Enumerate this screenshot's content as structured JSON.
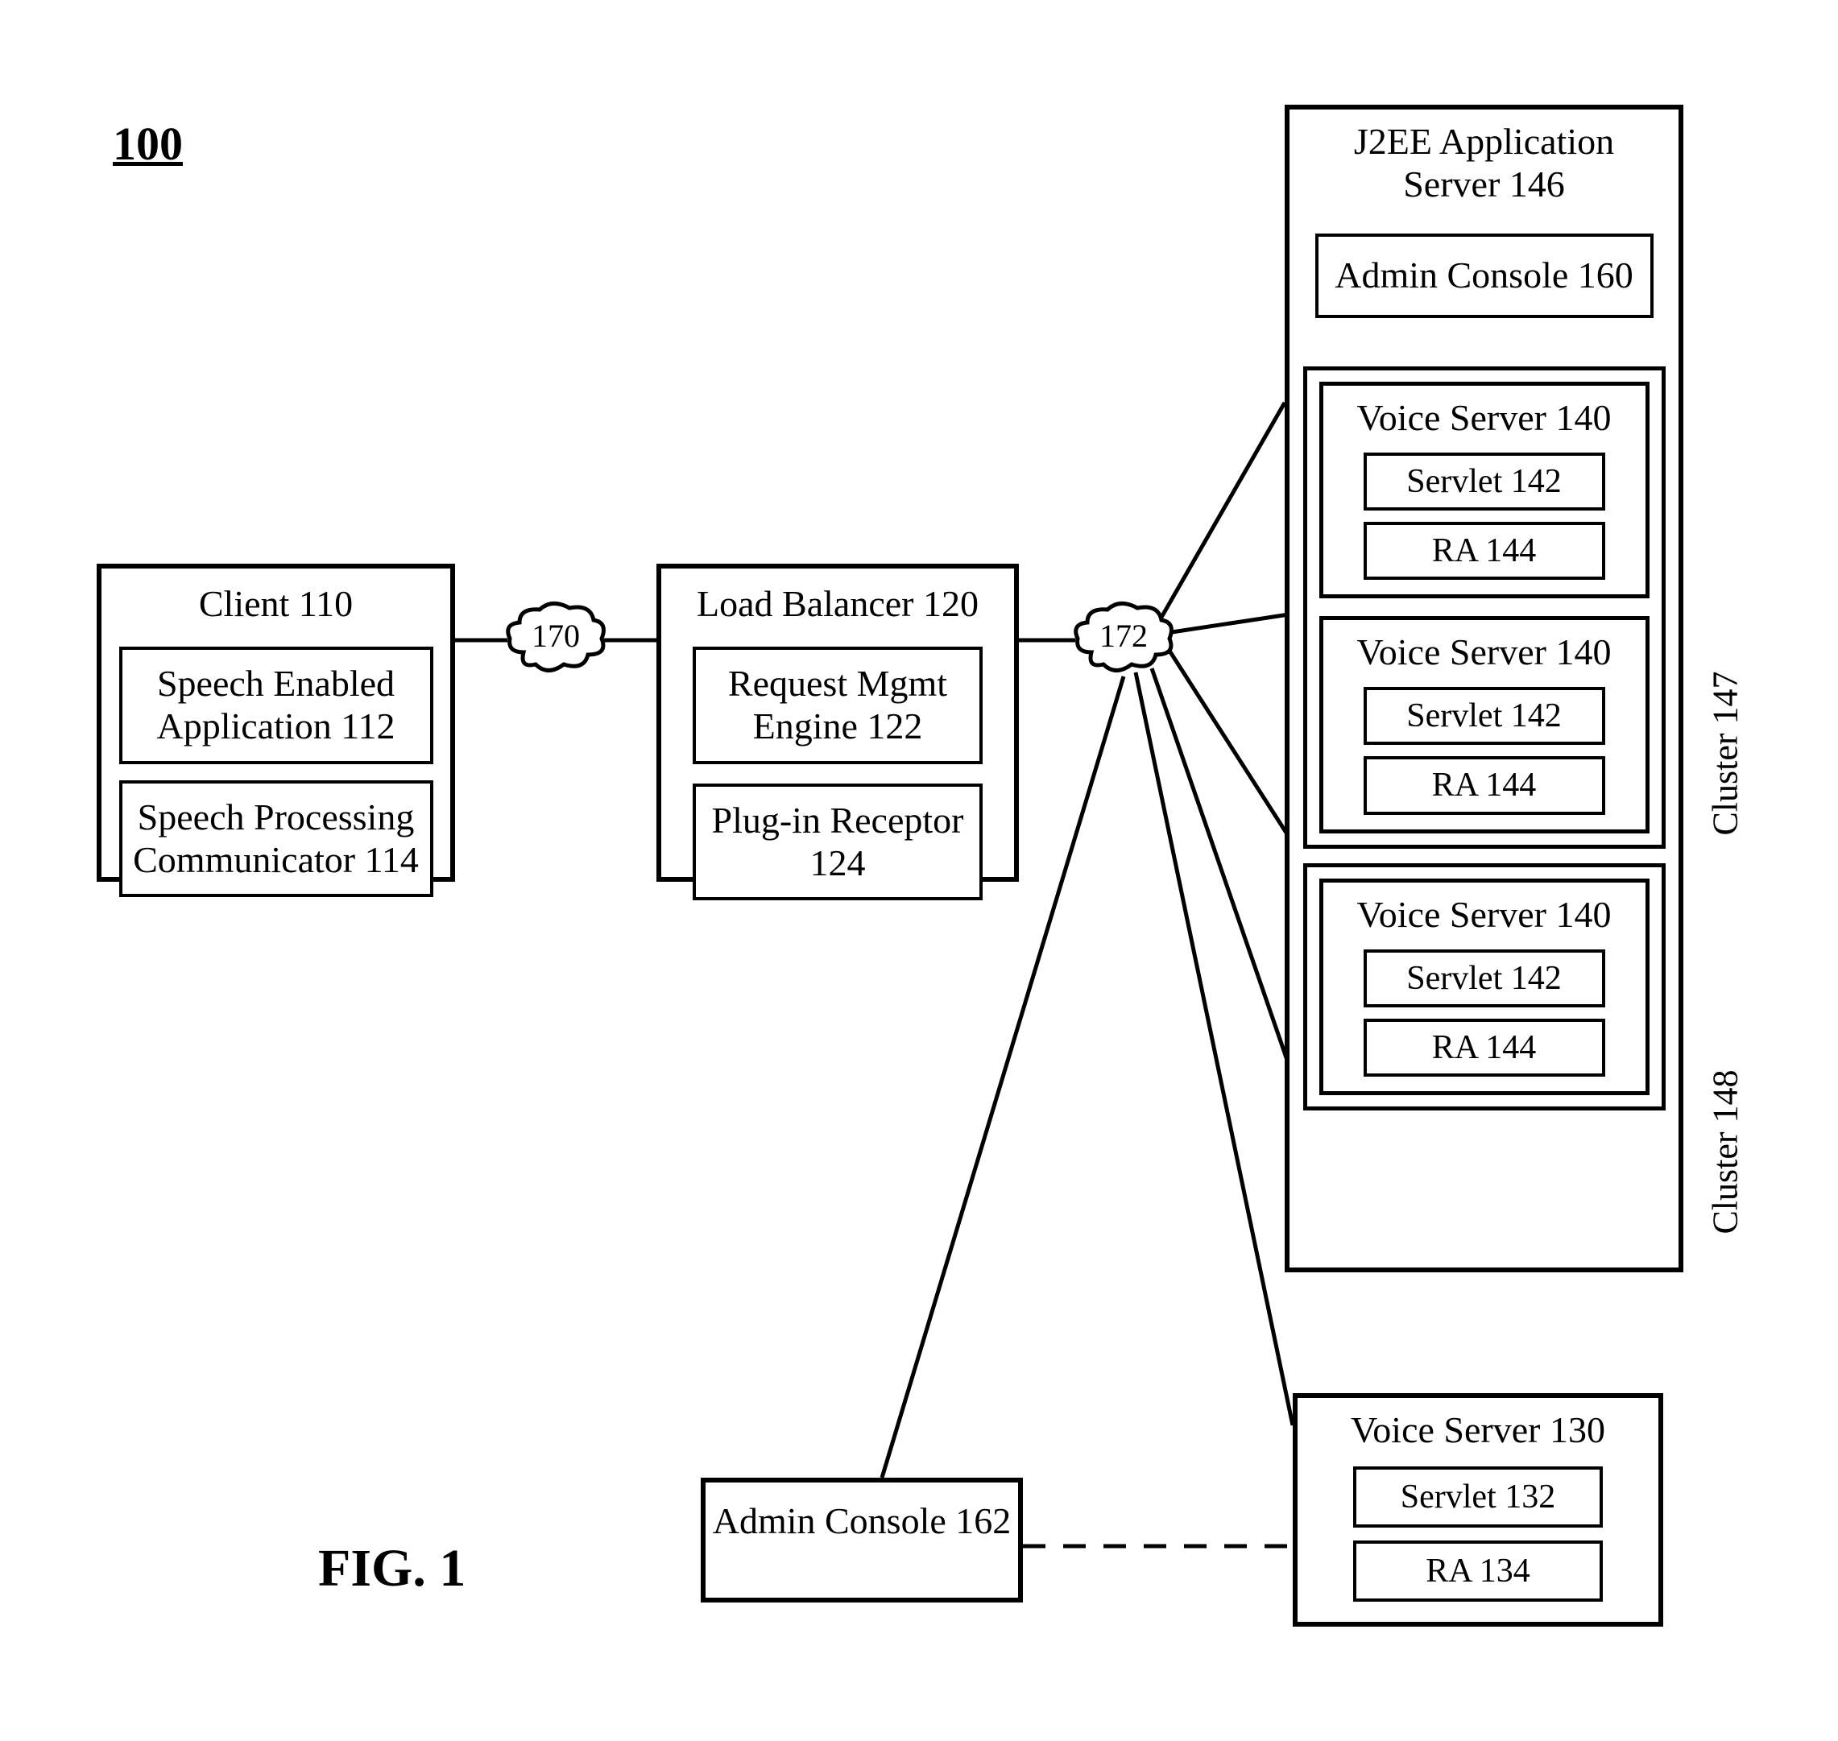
{
  "figure": {
    "ref": "100",
    "label": "FIG. 1"
  },
  "client": {
    "title": "Client 110",
    "app": "Speech Enabled Application 112",
    "comm": "Speech Processing Communicator 114"
  },
  "load_balancer": {
    "title": "Load Balancer 120",
    "engine": "Request Mgmt Engine 122",
    "receptor": "Plug-in Receptor 124"
  },
  "clouds": {
    "left": "170",
    "right": "172"
  },
  "j2ee": {
    "title": "J2EE Application Server 146",
    "admin": "Admin Console 160"
  },
  "voice_server": {
    "title": "Voice Server 140",
    "servlet": "Servlet 142",
    "ra": "RA 144"
  },
  "clusters": {
    "c147": "Cluster 147",
    "c148": "Cluster 148"
  },
  "admin_console_162": "Admin Console 162",
  "voice_server_130": {
    "title": "Voice Server 130",
    "servlet": "Servlet 132",
    "ra": "RA 134"
  }
}
